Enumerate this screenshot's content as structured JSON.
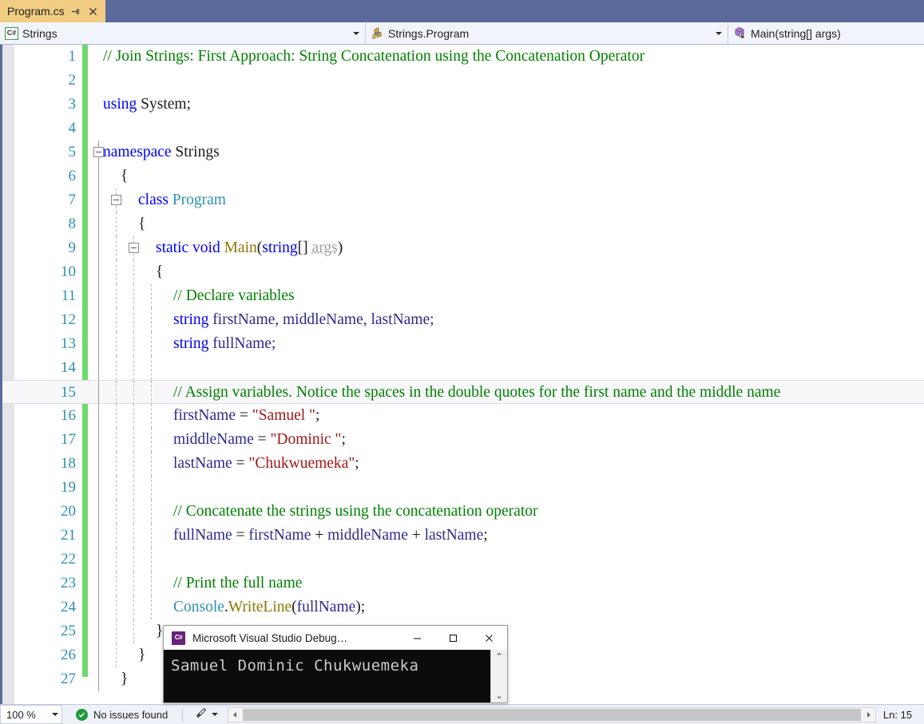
{
  "tab": {
    "label": "Program.cs",
    "pin_icon": "pin-icon",
    "close_icon": "close-icon"
  },
  "navbar": {
    "project": {
      "icon": "csharp-project-icon",
      "icon_text": "C#",
      "label": "Strings"
    },
    "type": {
      "icon": "class-icon",
      "label": "Strings.Program"
    },
    "member": {
      "icon": "method-icon",
      "label": "Main(string[] args)"
    }
  },
  "editor": {
    "lines": [
      {
        "n": "1",
        "tokens": [
          {
            "t": "// Join Strings: First Approach: String Concatenation using the Concatenation Operator",
            "c": "cmt"
          }
        ],
        "indent": 0
      },
      {
        "n": "2",
        "tokens": [],
        "indent": 0
      },
      {
        "n": "3",
        "tokens": [
          {
            "t": "using ",
            "c": "kw"
          },
          {
            "t": "System;",
            "c": "pln"
          }
        ],
        "indent": 0
      },
      {
        "n": "4",
        "tokens": [],
        "indent": 0
      },
      {
        "n": "5",
        "tokens": [
          {
            "t": "namespace ",
            "c": "kw"
          },
          {
            "t": "Strings",
            "c": "pln"
          }
        ],
        "indent": -1,
        "fold": true
      },
      {
        "n": "6",
        "tokens": [
          {
            "t": "{",
            "c": "pln"
          }
        ],
        "indent": 1
      },
      {
        "n": "7",
        "tokens": [
          {
            "t": "class ",
            "c": "kw"
          },
          {
            "t": "Program",
            "c": "typ"
          }
        ],
        "indent": 2,
        "fold": true
      },
      {
        "n": "8",
        "tokens": [
          {
            "t": "{",
            "c": "pln"
          }
        ],
        "indent": 2
      },
      {
        "n": "9",
        "tokens": [
          {
            "t": "static void ",
            "c": "kw"
          },
          {
            "t": "Main",
            "c": "mth"
          },
          {
            "t": "(",
            "c": "pln"
          },
          {
            "t": "string",
            "c": "kw"
          },
          {
            "t": "[] ",
            "c": "pln"
          },
          {
            "t": "args",
            "c": "gray"
          },
          {
            "t": ")",
            "c": "pln"
          }
        ],
        "indent": 3,
        "fold": true
      },
      {
        "n": "10",
        "tokens": [
          {
            "t": "{",
            "c": "pln"
          }
        ],
        "indent": 3
      },
      {
        "n": "11",
        "tokens": [
          {
            "t": "// Declare variables",
            "c": "cmt"
          }
        ],
        "indent": 4
      },
      {
        "n": "12",
        "tokens": [
          {
            "t": "string ",
            "c": "kw"
          },
          {
            "t": "firstName, middleName, lastName;",
            "c": "ident"
          }
        ],
        "indent": 4
      },
      {
        "n": "13",
        "tokens": [
          {
            "t": "string ",
            "c": "kw"
          },
          {
            "t": "fullName;",
            "c": "ident"
          }
        ],
        "indent": 4
      },
      {
        "n": "14",
        "tokens": [],
        "indent": 0
      },
      {
        "n": "15",
        "tokens": [
          {
            "t": "// Assign variables. Notice the spaces in the double quotes for the first name and the middle name",
            "c": "cmt"
          }
        ],
        "indent": 4,
        "current": true
      },
      {
        "n": "16",
        "tokens": [
          {
            "t": "firstName ",
            "c": "ident"
          },
          {
            "t": "= ",
            "c": "pln"
          },
          {
            "t": "\"Samuel \"",
            "c": "str"
          },
          {
            "t": ";",
            "c": "pln"
          }
        ],
        "indent": 4
      },
      {
        "n": "17",
        "tokens": [
          {
            "t": "middleName ",
            "c": "ident"
          },
          {
            "t": "= ",
            "c": "pln"
          },
          {
            "t": "\"Dominic \"",
            "c": "str"
          },
          {
            "t": ";",
            "c": "pln"
          }
        ],
        "indent": 4
      },
      {
        "n": "18",
        "tokens": [
          {
            "t": "lastName ",
            "c": "ident"
          },
          {
            "t": "= ",
            "c": "pln"
          },
          {
            "t": "\"Chukwuemeka\"",
            "c": "str"
          },
          {
            "t": ";",
            "c": "pln"
          }
        ],
        "indent": 4
      },
      {
        "n": "19",
        "tokens": [],
        "indent": 0
      },
      {
        "n": "20",
        "tokens": [
          {
            "t": "// Concatenate the strings using the concatenation operator",
            "c": "cmt"
          }
        ],
        "indent": 4
      },
      {
        "n": "21",
        "tokens": [
          {
            "t": "fullName ",
            "c": "ident"
          },
          {
            "t": "= ",
            "c": "pln"
          },
          {
            "t": "firstName ",
            "c": "ident"
          },
          {
            "t": "+ ",
            "c": "pln"
          },
          {
            "t": "middleName ",
            "c": "ident"
          },
          {
            "t": "+ ",
            "c": "pln"
          },
          {
            "t": "lastName",
            "c": "ident"
          },
          {
            "t": ";",
            "c": "pln"
          }
        ],
        "indent": 4
      },
      {
        "n": "22",
        "tokens": [],
        "indent": 0
      },
      {
        "n": "23",
        "tokens": [
          {
            "t": "// Print the full name",
            "c": "cmt"
          }
        ],
        "indent": 4
      },
      {
        "n": "24",
        "tokens": [
          {
            "t": "Console",
            "c": "typ"
          },
          {
            "t": ".",
            "c": "pln"
          },
          {
            "t": "WriteLine",
            "c": "mth"
          },
          {
            "t": "(",
            "c": "pln"
          },
          {
            "t": "fullName",
            "c": "ident"
          },
          {
            "t": ");",
            "c": "pln"
          }
        ],
        "indent": 4
      },
      {
        "n": "25",
        "tokens": [
          {
            "t": "}",
            "c": "pln"
          }
        ],
        "indent": 3
      },
      {
        "n": "26",
        "tokens": [
          {
            "t": "}",
            "c": "pln"
          }
        ],
        "indent": 2
      },
      {
        "n": "27",
        "tokens": [
          {
            "t": "}",
            "c": "pln"
          }
        ],
        "indent": 1
      }
    ]
  },
  "console": {
    "title": "Microsoft Visual Studio Debug…",
    "icon_text": "C#",
    "output": "Samuel Dominic Chukwuemeka",
    "minimize_icon": "minimize-icon",
    "maximize_icon": "maximize-icon",
    "close_icon": "close-icon",
    "scroll_up_icon": "chevron-up-icon",
    "scroll_down_icon": "chevron-down-icon"
  },
  "statusbar": {
    "zoom": "100 %",
    "issues": "No issues found",
    "issues_icon": "check-circle-icon",
    "brush_icon": "brush-icon",
    "line_position": "Ln: 15"
  },
  "colors": {
    "tab_active": "#f0cd82",
    "tabstrip": "#5b6a9a",
    "changebar": "#6fd96f",
    "keyword": "#0000ff",
    "comment": "#008000",
    "string": "#a31515",
    "type": "#2b91af",
    "linenumber": "#2b91af",
    "console_bg": "#0c0c0c",
    "console_icon": "#68217a",
    "ok_green": "#1d9c3a"
  }
}
